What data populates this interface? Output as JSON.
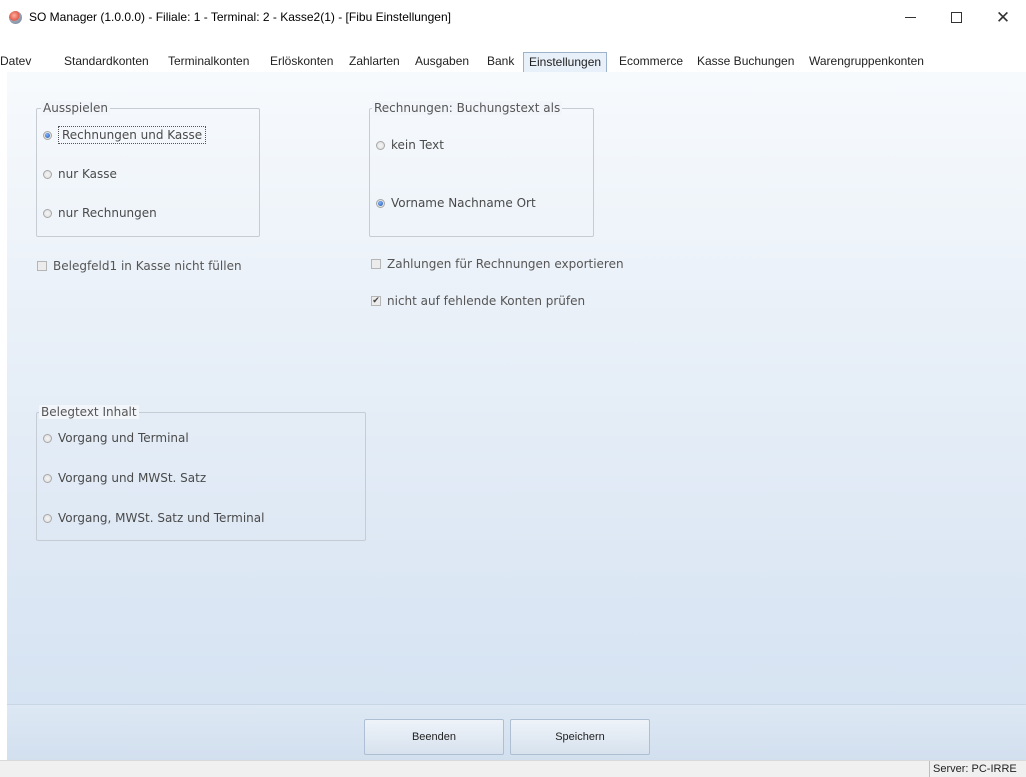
{
  "window": {
    "title": "SO Manager (1.0.0.0) - Filiale: 1 - Terminal: 2 -  Kasse2(1) - [Fibu Einstellungen]"
  },
  "tabs": [
    {
      "label": "Datev"
    },
    {
      "label": "Standardkonten"
    },
    {
      "label": "Terminalkonten"
    },
    {
      "label": "Erlöskonten"
    },
    {
      "label": "Zahlarten"
    },
    {
      "label": "Ausgaben"
    },
    {
      "label": "Bank"
    },
    {
      "label": "Einstellungen",
      "active": true
    },
    {
      "label": "Ecommerce"
    },
    {
      "label": "Kasse Buchungen"
    },
    {
      "label": "Warengruppenkonten"
    }
  ],
  "ausspielen": {
    "legend": "Ausspielen",
    "options": [
      {
        "label": "Rechnungen und Kasse",
        "checked": true
      },
      {
        "label": "nur Kasse",
        "checked": false
      },
      {
        "label": "nur Rechnungen",
        "checked": false
      }
    ]
  },
  "buchungstext": {
    "legend": "Rechnungen: Buchungstext als",
    "options": [
      {
        "label": "kein Text",
        "checked": false
      },
      {
        "label": "Vorname Nachname Ort",
        "checked": true
      }
    ]
  },
  "checkboxes": {
    "belegfeld": {
      "label": "Belegfeld1 in Kasse nicht füllen",
      "checked": false
    },
    "zahlungen": {
      "label": "Zahlungen für Rechnungen exportieren",
      "checked": false
    },
    "konten": {
      "label": "nicht auf fehlende Konten prüfen",
      "checked": true
    }
  },
  "belegtext": {
    "legend": "Belegtext Inhalt",
    "options": [
      {
        "label": "Vorgang und Terminal",
        "checked": false
      },
      {
        "label": "Vorgang und MWSt. Satz",
        "checked": false
      },
      {
        "label": "Vorgang, MWSt. Satz und Terminal",
        "checked": false
      }
    ]
  },
  "buttons": {
    "beenden": "Beenden",
    "speichern": "Speichern"
  },
  "status": {
    "server": "Server: PC-IRRE"
  }
}
